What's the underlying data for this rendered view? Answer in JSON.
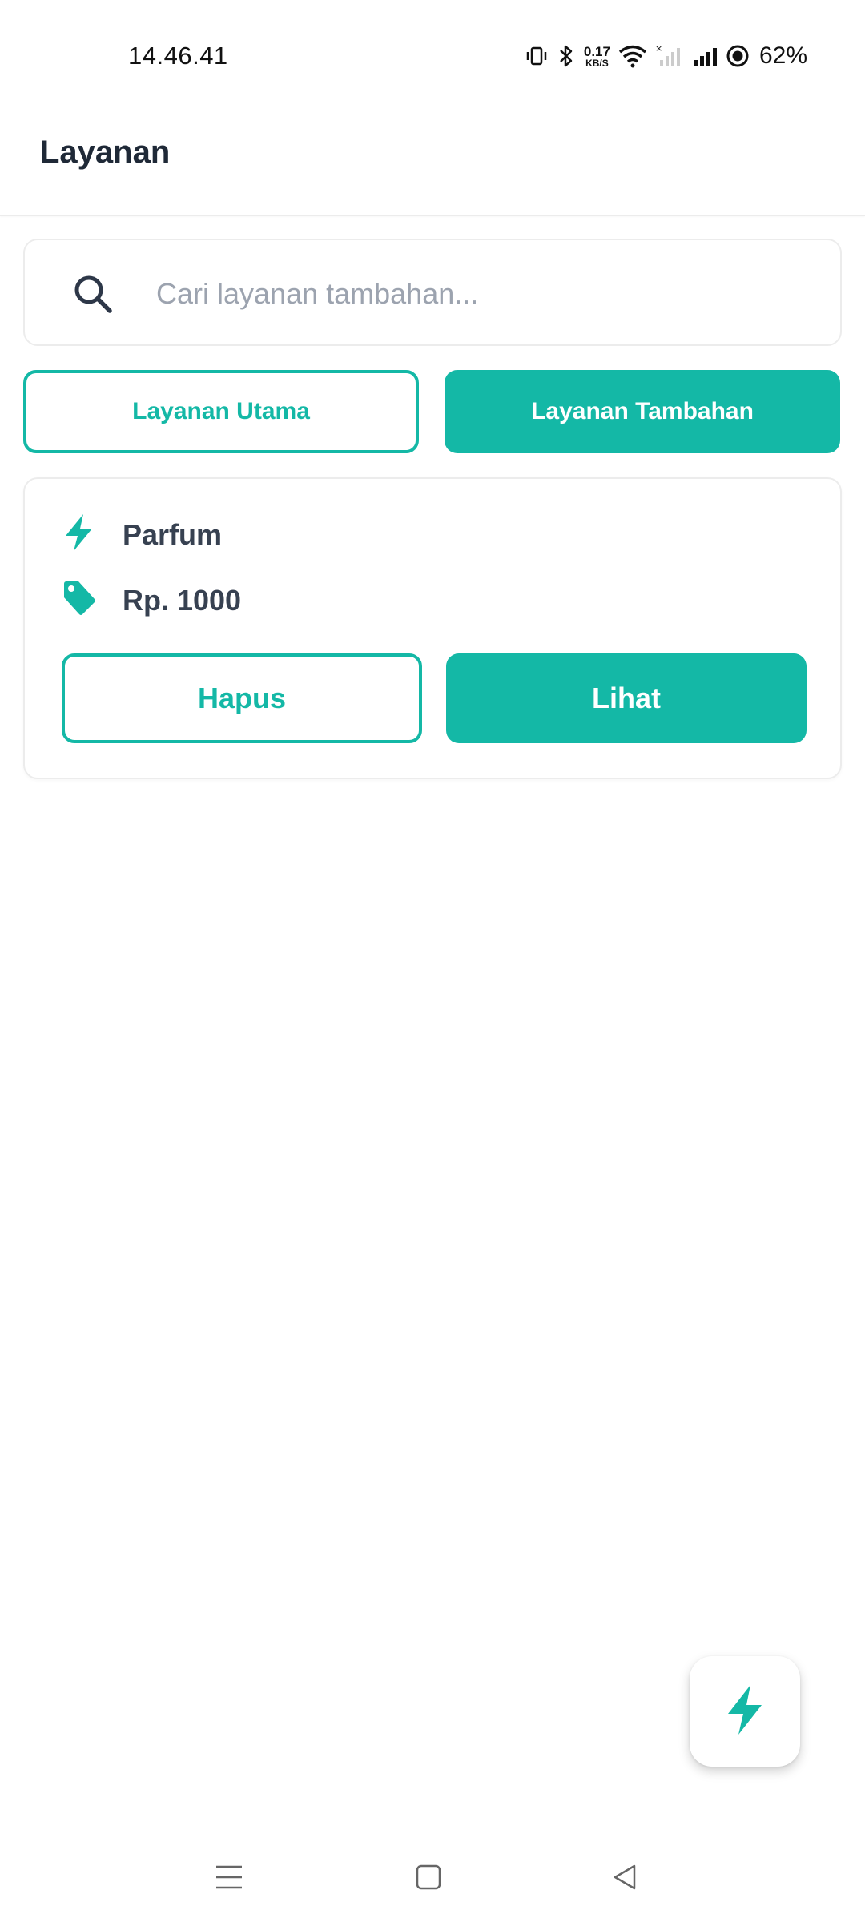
{
  "status_bar": {
    "time": "14.46.41",
    "net_speed_value": "0.17",
    "net_speed_unit": "KB/S",
    "battery": "62%"
  },
  "header": {
    "title": "Layanan"
  },
  "search": {
    "placeholder": "Cari layanan tambahan...",
    "value": ""
  },
  "tabs": [
    {
      "label": "Layanan Utama",
      "active": false
    },
    {
      "label": "Layanan Tambahan",
      "active": true
    }
  ],
  "services": [
    {
      "name": "Parfum",
      "price": "Rp. 1000",
      "delete_label": "Hapus",
      "view_label": "Lihat"
    }
  ],
  "icons": {
    "service_name": "bolt-icon",
    "service_price": "tag-icon",
    "fab": "bolt-icon",
    "search": "search-icon"
  },
  "colors": {
    "accent": "#14b8a6",
    "text_primary": "#1f2937",
    "text_secondary": "#374151",
    "placeholder": "#9ca3af",
    "border": "#ececec"
  }
}
